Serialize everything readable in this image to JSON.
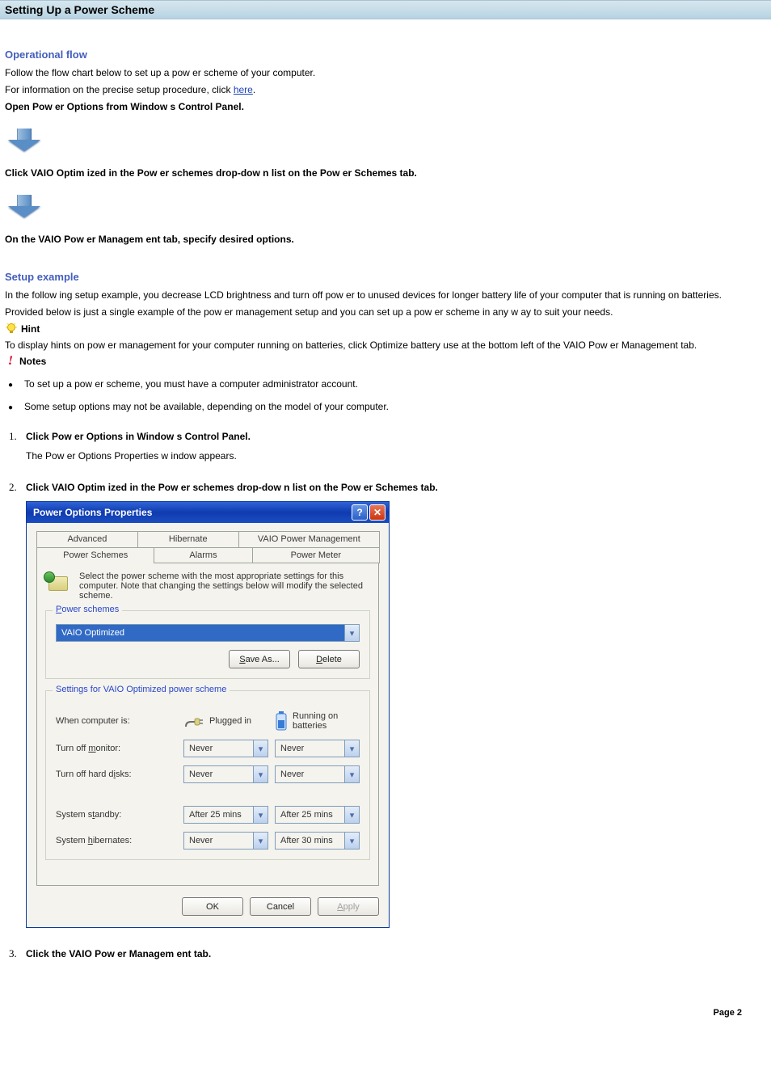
{
  "page": {
    "title": "Setting Up a Power Scheme",
    "footer": "Page 2"
  },
  "operational_flow": {
    "heading": "Operational flow",
    "line1": "Follow  the flow chart below  to set up a pow er scheme of your computer.",
    "line2_pre": "For information on the precise setup procedure, click ",
    "line2_link": "here",
    "line2_post": ".",
    "step1": "Open Pow er Options from  Window s Control Panel.",
    "step2": "Click VAIO Optim ized in the Pow er schemes drop-dow n list on the Pow er Schemes tab.",
    "step3": "On the VAIO Pow er Managem ent tab, specify desired options."
  },
  "setup_example": {
    "heading": "Setup example",
    "para1": "In the follow ing setup example, you decrease LCD brightness and turn off pow er to unused devices for longer battery life of your computer that is running on batteries.",
    "para2": "Provided below  is just a single example of the pow er management setup and you can set up a pow er scheme in any w ay to suit your needs.",
    "hint_label": "Hint",
    "hint_text": "To display hints on pow er management for your computer running on batteries, click Optimize battery use at the bottom left of the VAIO Pow er Management tab.",
    "notes_label": "Notes",
    "notes": [
      "To set up a pow er scheme, you must have a computer administrator account.",
      "Some setup options may not be available, depending on the model of your computer."
    ]
  },
  "steps": {
    "s1_title": "Click Pow er Options in Window s Control Panel.",
    "s1_sub": "The Pow er Options Properties w indow  appears.",
    "s2_title": "Click VAIO Optim ized in the Pow er schemes drop-dow n list on the Pow er Schemes tab.",
    "s3_title": "Click the VAIO Pow er Managem ent tab."
  },
  "dialog": {
    "title": "Power Options Properties",
    "tabs_row1": [
      "Advanced",
      "Hibernate",
      "VAIO Power Management"
    ],
    "tabs_row2": [
      "Power Schemes",
      "Alarms",
      "Power Meter"
    ],
    "intro": "Select the power scheme with the most appropriate settings for this computer. Note that changing the settings below will modify the selected scheme.",
    "group1_legend": "Power schemes",
    "scheme_selected": "VAIO Optimized",
    "save_as_u": "S",
    "save_as_rest": "ave As...",
    "delete_u": "D",
    "delete_rest": "elete",
    "group2_legend": "Settings for VAIO Optimized power scheme",
    "when_label": "When computer is:",
    "plugged": "Plugged in",
    "running": "Running on batteries",
    "rows": [
      {
        "label_pre": "Turn off ",
        "label_u": "m",
        "label_post": "onitor:",
        "plugged": "Never",
        "battery": "Never"
      },
      {
        "label_pre": "Turn off hard d",
        "label_u": "i",
        "label_post": "sks:",
        "plugged": "Never",
        "battery": "Never"
      },
      {
        "label_pre": "System s",
        "label_u": "t",
        "label_post": "andby:",
        "plugged": "After 25 mins",
        "battery": "After 25 mins"
      },
      {
        "label_pre": "System ",
        "label_u": "h",
        "label_post": "ibernates:",
        "plugged": "Never",
        "battery": "After 30 mins"
      }
    ],
    "ok": "OK",
    "cancel": "Cancel",
    "apply_u": "A",
    "apply_rest": "pply"
  }
}
